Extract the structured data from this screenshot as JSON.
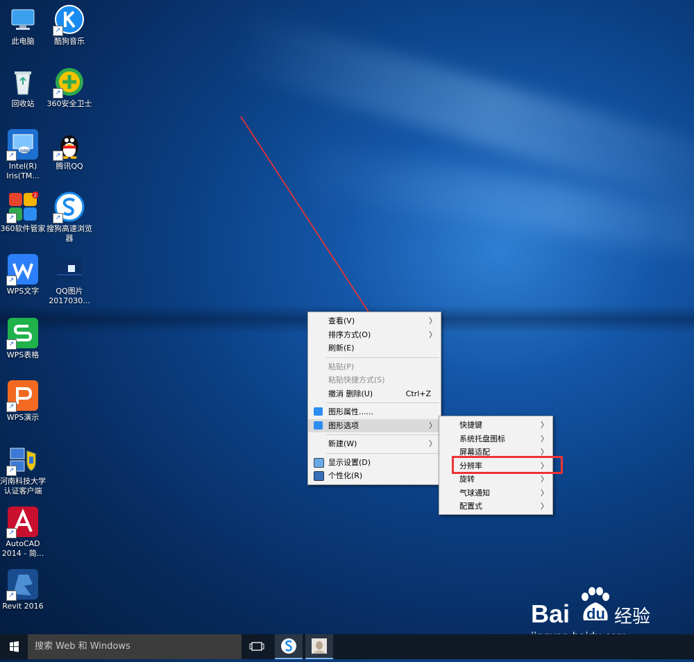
{
  "desktop_icons": [
    {
      "label": "此电脑",
      "shortcut": false
    },
    {
      "label": "酷狗音乐",
      "shortcut": true
    },
    {
      "label": "回收站",
      "shortcut": false
    },
    {
      "label": "360安全卫士",
      "shortcut": true
    },
    {
      "label": "Intel(R) Iris(TM...",
      "shortcut": true
    },
    {
      "label": "腾讯QQ",
      "shortcut": true
    },
    {
      "label": "360软件管家",
      "shortcut": true
    },
    {
      "label": "搜狗高速浏览器",
      "shortcut": true
    },
    {
      "label": "WPS文字",
      "shortcut": true
    },
    {
      "label": "QQ图片2017030...",
      "shortcut": false
    },
    {
      "label": "WPS表格",
      "shortcut": true
    },
    {
      "label": "WPS演示",
      "shortcut": true
    },
    {
      "label": "河南科技大学认证客户端",
      "shortcut": true
    },
    {
      "label": "AutoCAD 2014 - 简...",
      "shortcut": true
    },
    {
      "label": "Revit 2016",
      "shortcut": true
    }
  ],
  "context_menu": {
    "view": "查看(V)",
    "sort": "排序方式(O)",
    "refresh": "刷新(E)",
    "paste": "粘贴(P)",
    "paste_shortcut": "粘贴快捷方式(S)",
    "undo": "撤消 删除(U)",
    "undo_accel": "Ctrl+Z",
    "graphics_props": "图形属性......",
    "graphics_options": "图形选项",
    "new": "新建(W)",
    "display_settings": "显示设置(D)",
    "personalize": "个性化(R)"
  },
  "submenu": {
    "hotkeys": "快捷键",
    "tray_icon": "系统托盘图标",
    "screen_fit": "屏幕适配",
    "resolution": "分辨率",
    "rotation": "旋转",
    "balloon": "气球通知",
    "profiles": "配置式"
  },
  "taskbar": {
    "search_placeholder": "搜索 Web 和 Windows"
  },
  "watermark": {
    "brand": "Bai",
    "brand2": "du",
    "jingyan": "经验",
    "url": "jingyan.baidu.com"
  },
  "colors": {
    "highlight_box": "#e33333",
    "annotation_arrow": "#e33333",
    "menu_bg": "#f2f2f2",
    "taskbar": "#101a26"
  }
}
